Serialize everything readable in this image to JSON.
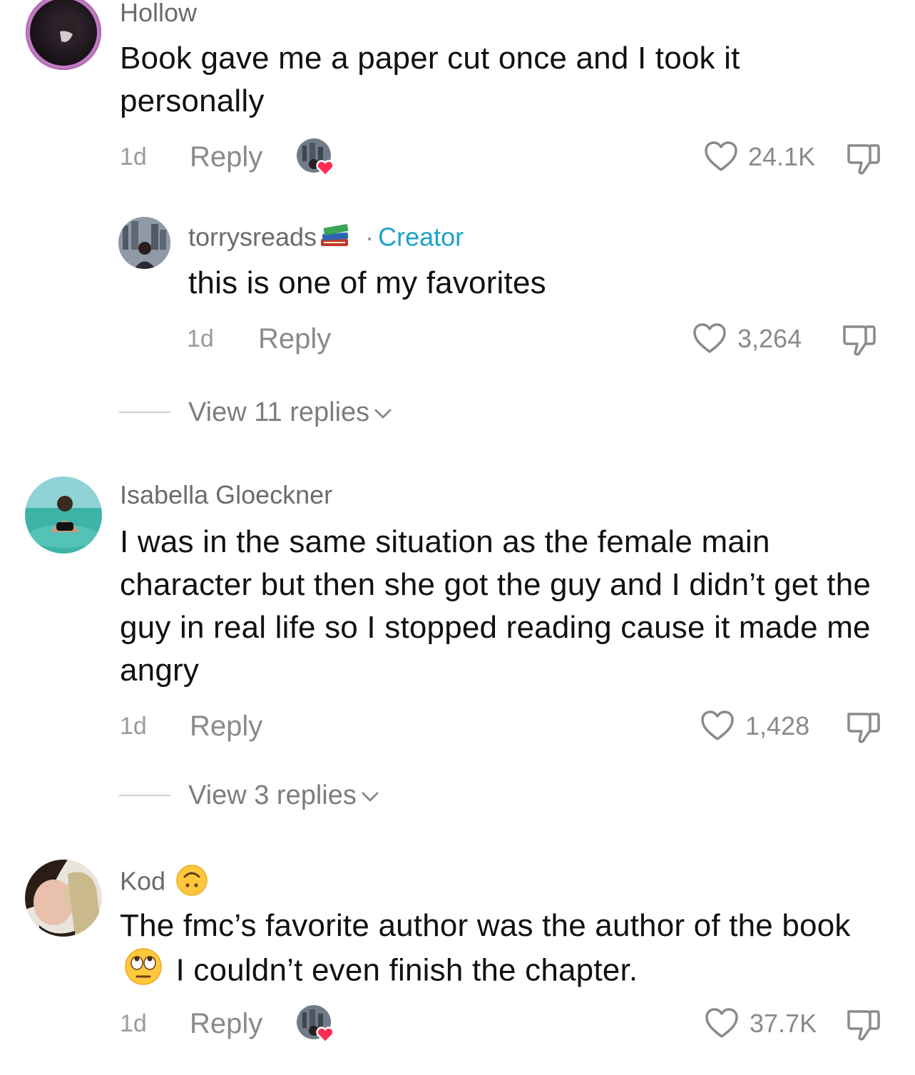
{
  "comments": [
    {
      "username": "Hollow",
      "text": "Book gave me a paper cut once and I took it personally",
      "time": "1d",
      "reply_label": "Reply",
      "likes": "24.1K"
    },
    {
      "username": "torrysreads",
      "badge_separator": "·",
      "badge": "Creator",
      "text": "this is one of my favorites",
      "time": "1d",
      "reply_label": "Reply",
      "likes": "3,264",
      "view_replies": "View 11 replies"
    },
    {
      "username": "Isabella Gloeckner",
      "text": "I was in the same situation as the female main character but then she got the guy and I didn’t get the guy in real life so I stopped reading cause it made me angry",
      "time": "1d",
      "reply_label": "Reply",
      "likes": "1,428",
      "view_replies": "View 3 replies"
    },
    {
      "username": "Kod",
      "text_part1": "The fmc’s favorite author was the author of the book",
      "text_part2": "I couldn’t even finish the chapter.",
      "time": "1d",
      "reply_label": "Reply",
      "likes": "37.7K"
    }
  ],
  "colors": {
    "creator_badge": "#1da1c9",
    "heart_badge": "#fe2c55",
    "meta_gray": "#8a8a8a"
  },
  "icons": [
    "heart-outline-icon",
    "thumbs-down-icon",
    "chevron-down-icon",
    "books-emoji",
    "upside-down-face-emoji",
    "eye-roll-emoji"
  ]
}
